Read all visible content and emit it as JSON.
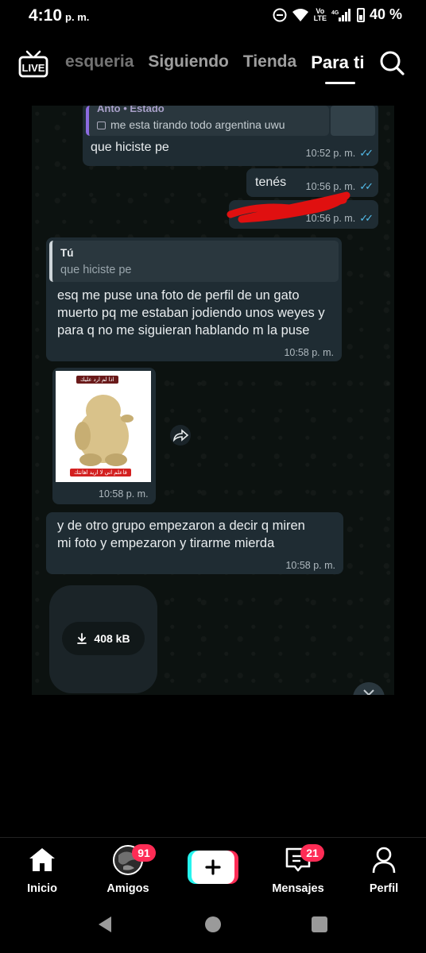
{
  "status_bar": {
    "time": "4:10",
    "ampm": "p. m.",
    "network_volte": "Vo\nLTE",
    "network_4g": "4G",
    "battery": "40 %"
  },
  "top_nav": {
    "tabs": [
      {
        "label": "esqueria"
      },
      {
        "label": "Siguiendo"
      },
      {
        "label": "Tienda"
      },
      {
        "label": "Para ti",
        "active": true
      }
    ]
  },
  "chat": {
    "messages": [
      {
        "reply_author": "Anto • Estado",
        "reply_text": "me esta tirando todo argentina uwu",
        "text": "que hiciste pe",
        "time": "10:52 p. m."
      },
      {
        "text": "tenés",
        "time": "10:56 p. m."
      },
      {
        "time": "10:56 p. m."
      },
      {
        "reply_author": "Tú",
        "reply_text": "que hiciste pe",
        "text": "esq me puse una foto de perfil de un gato muerto pq me estaban jodiendo unos weyes y para q no me siguieran hablando m la puse",
        "time": "10:58 p. m."
      },
      {
        "image_text_top": "اذا لم ارد عليك",
        "image_text_bottom": "فاعلم اني لا اريد اهانتك",
        "time": "10:58 p. m."
      },
      {
        "text": "y de otro grupo empezaron a decir q miren mi foto y empezaron y tirarme mierda",
        "time": "10:58 p. m."
      },
      {
        "file_size": "408 kB"
      }
    ]
  },
  "bottom_nav": {
    "items": [
      {
        "label": "Inicio"
      },
      {
        "label": "Amigos",
        "badge": "91"
      },
      {
        "label": "Mensajes",
        "badge": "21"
      },
      {
        "label": "Perfil"
      }
    ]
  },
  "colors": {
    "accent_red": "#fe2c55",
    "accent_cyan": "#25f4ee",
    "bubble": "#1f2c33",
    "read_ticks": "#53bdeb"
  }
}
